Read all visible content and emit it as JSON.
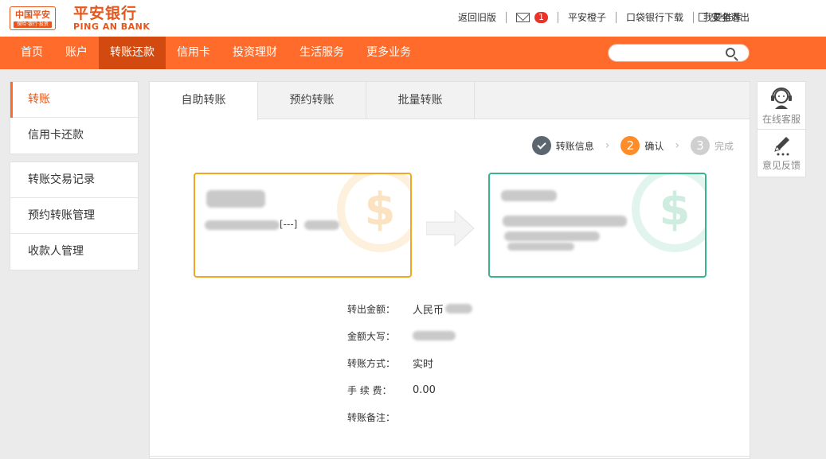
{
  "logo": {
    "group_name": "中国平安",
    "group_sub": "保险·银行·投资",
    "bank_cn": "平安银行",
    "bank_en": "PING AN BANK"
  },
  "toplinks": {
    "old_version": "返回旧版",
    "mail_count": "1",
    "orange": "平安橙子",
    "pocket": "口袋银行下载",
    "recommend": "我要推荐",
    "logout": "安全退出"
  },
  "nav": {
    "items": [
      "首页",
      "账户",
      "转账还款",
      "信用卡",
      "投资理财",
      "生活服务",
      "更多业务"
    ],
    "active_index": 2
  },
  "search": {
    "placeholder": ""
  },
  "sidebar": {
    "group1": [
      "转账",
      "信用卡还款"
    ],
    "group2": [
      "转账交易记录",
      "预约转账管理",
      "收款人管理"
    ]
  },
  "tabs": [
    "自助转账",
    "预约转账",
    "批量转账"
  ],
  "steps": [
    {
      "num": "✓",
      "label": "转账信息",
      "state": "done"
    },
    {
      "num": "2",
      "label": "确认",
      "state": "current"
    },
    {
      "num": "3",
      "label": "完成",
      "state": "todo"
    }
  ],
  "cards": {
    "out_account_suffix": "[---]"
  },
  "details": {
    "amount_label": "转出金额：",
    "amount_value": "人民币",
    "upper_label": "金额大写：",
    "upper_value": "",
    "mode_label": "转账方式：",
    "mode_value": "实时",
    "fee_label": "手 续 费：",
    "fee_value": "0.00",
    "note_label": "转账备注：",
    "note_value": ""
  },
  "float": {
    "service": "在线客服",
    "feedback": "意见反馈"
  },
  "colors": {
    "brand": "#ff6b2a",
    "nav_active": "#d24a0f",
    "out_card": "#f2a623",
    "in_card": "#3ab48f"
  }
}
